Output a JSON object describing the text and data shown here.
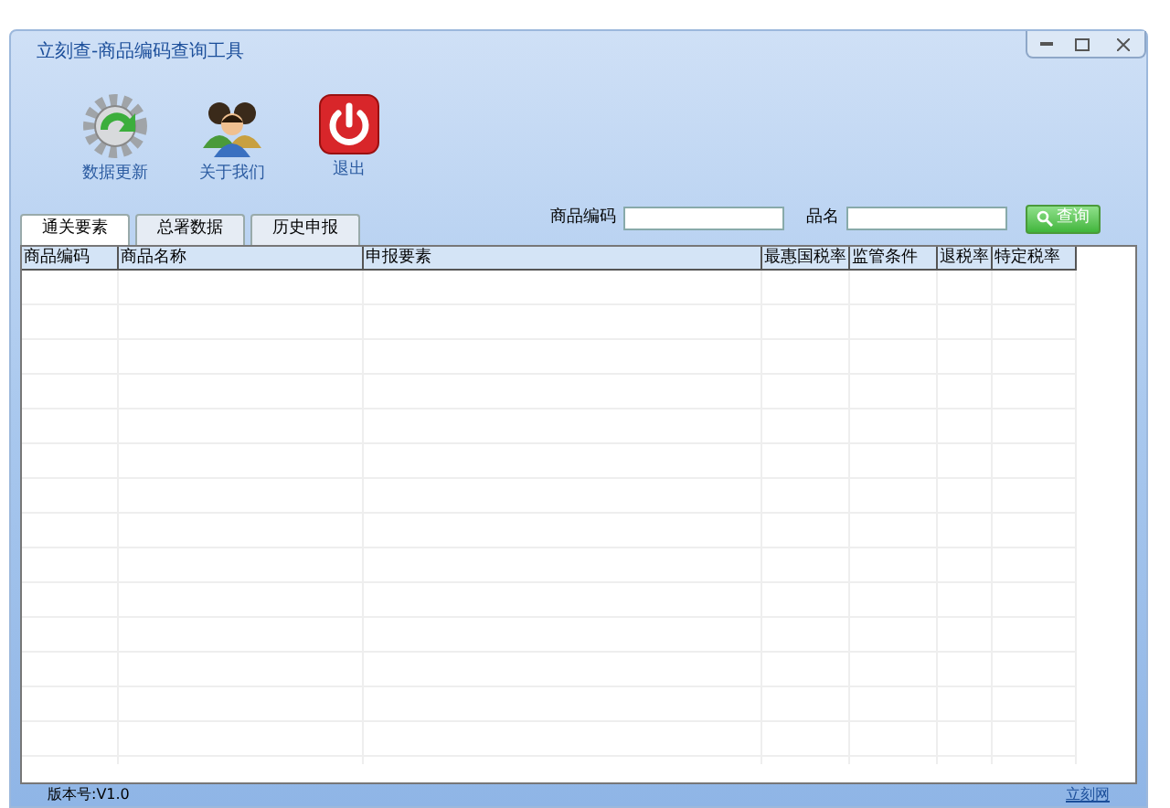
{
  "window": {
    "title": "立刻查-商品编码查询工具"
  },
  "toolbar": [
    {
      "kind": "update",
      "label": "数据更新"
    },
    {
      "kind": "about",
      "label": "关于我们"
    },
    {
      "kind": "exit",
      "label": "退出"
    }
  ],
  "search": {
    "code_label": "商品编码",
    "name_label": "品名",
    "button": "查询"
  },
  "tabs": [
    {
      "label": "通关要素",
      "selected": true
    },
    {
      "label": "总署数据",
      "selected": false
    },
    {
      "label": "历史申报",
      "selected": false
    }
  ],
  "table": {
    "columns": [
      "商品编码",
      "商品名称",
      "申报要素",
      "最惠国税率",
      "监管条件",
      "退税率",
      "特定税率"
    ]
  },
  "status_bar": {
    "version": "版本号:V1.0",
    "site": "立刻网"
  }
}
